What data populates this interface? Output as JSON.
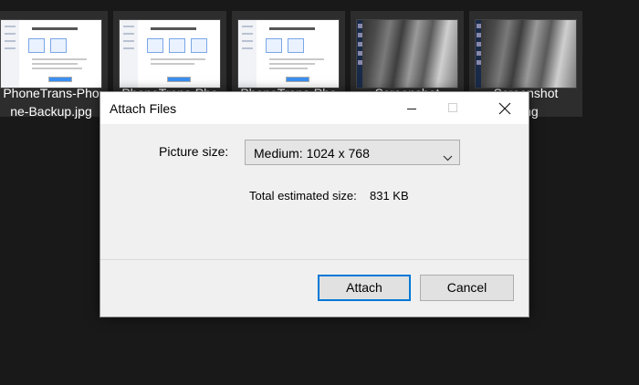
{
  "explorer": {
    "files": [
      {
        "name": "PhoneTrans-Pho\nne-Backup.jpg",
        "kind": "app-screenshot"
      },
      {
        "name": "PhoneTrans-Pho",
        "kind": "app-screenshot"
      },
      {
        "name": "PhoneTrans-Pho",
        "kind": "app-screenshot"
      },
      {
        "name": "Screenshot",
        "kind": "photo"
      },
      {
        "name": "Screenshot\n.png",
        "kind": "photo"
      }
    ]
  },
  "dialog": {
    "title": "Attach Files",
    "picture_size_label": "Picture size:",
    "picture_size_value": "Medium: 1024 x 768",
    "total_label": "Total estimated size:",
    "total_value": "831 KB",
    "attach_label": "Attach",
    "cancel_label": "Cancel"
  },
  "icons": {
    "minimize": "minimize-icon",
    "maximize": "maximize-icon",
    "close": "close-icon",
    "dropdown": "chevron-down-icon"
  },
  "colors": {
    "background": "#191919",
    "dialog": "#f0f0f0",
    "accent": "#0078d7"
  }
}
